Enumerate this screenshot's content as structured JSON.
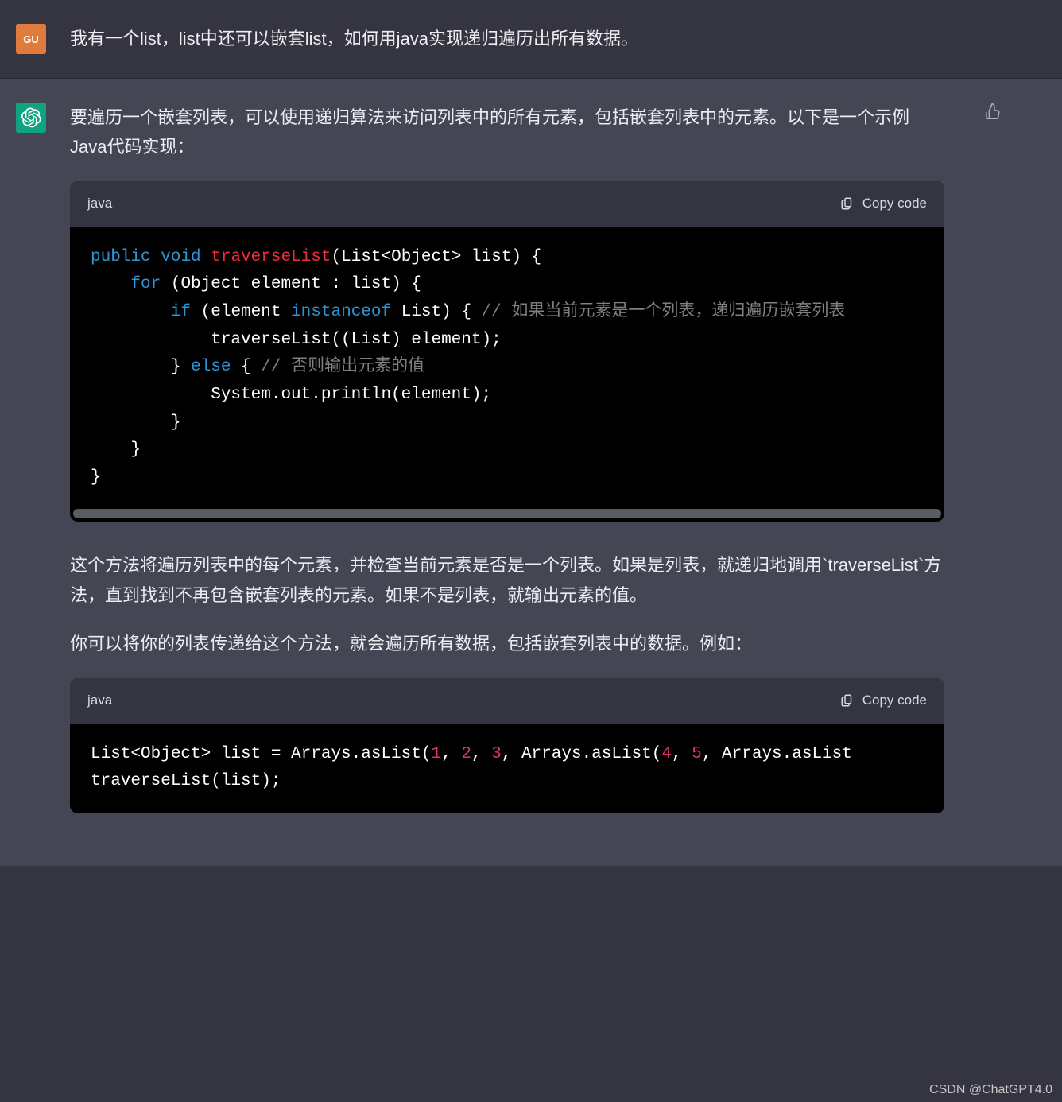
{
  "user": {
    "avatar_text": "GU",
    "message": "我有一个list，list中还可以嵌套list，如何用java实现递归遍历出所有数据。"
  },
  "assistant": {
    "para1": "要遍历一个嵌套列表，可以使用递归算法来访问列表中的所有元素，包括嵌套列表中的元素。以下是一个示例Java代码实现：",
    "code1": {
      "lang": "java",
      "copy_label": "Copy code",
      "tokens": {
        "public": "public",
        "void": "void",
        "traverseList": "traverseList",
        "sig_rest": "(List<Object> list) {",
        "for": "for",
        "for_rest": " (Object element : list) {",
        "if": "if",
        "if_open": " (element ",
        "instanceof": "instanceof",
        "if_rest": " List) { ",
        "cmt1": "// 如果当前元素是一个列表，递归遍历嵌套列表",
        "call": "            traverseList((List) element);",
        "else_close": "        } ",
        "else": "else",
        "else_open": " { ",
        "cmt2": "// 否则输出元素的值",
        "println": "            System.out.println(element);",
        "brace1": "        }",
        "brace2": "    }",
        "brace3": "}"
      }
    },
    "para2": "这个方法将遍历列表中的每个元素，并检查当前元素是否是一个列表。如果是列表，就递归地调用`traverseList`方法，直到找到不再包含嵌套列表的元素。如果不是列表，就输出元素的值。",
    "para3": "你可以将你的列表传递给这个方法，就会遍历所有数据，包括嵌套列表中的数据。例如：",
    "code2": {
      "lang": "java",
      "copy_label": "Copy code",
      "tokens": {
        "line1_a": "List<Object> list = Arrays.asList(",
        "n1": "1",
        "c1": ", ",
        "n2": "2",
        "c2": ", ",
        "n3": "3",
        "c3": ", Arrays.asList(",
        "n4": "4",
        "c4": ", ",
        "n5": "5",
        "c5": ", Arrays.asList",
        "line2": "traverseList(list);"
      }
    }
  },
  "watermark": "CSDN @ChatGPT4.0"
}
